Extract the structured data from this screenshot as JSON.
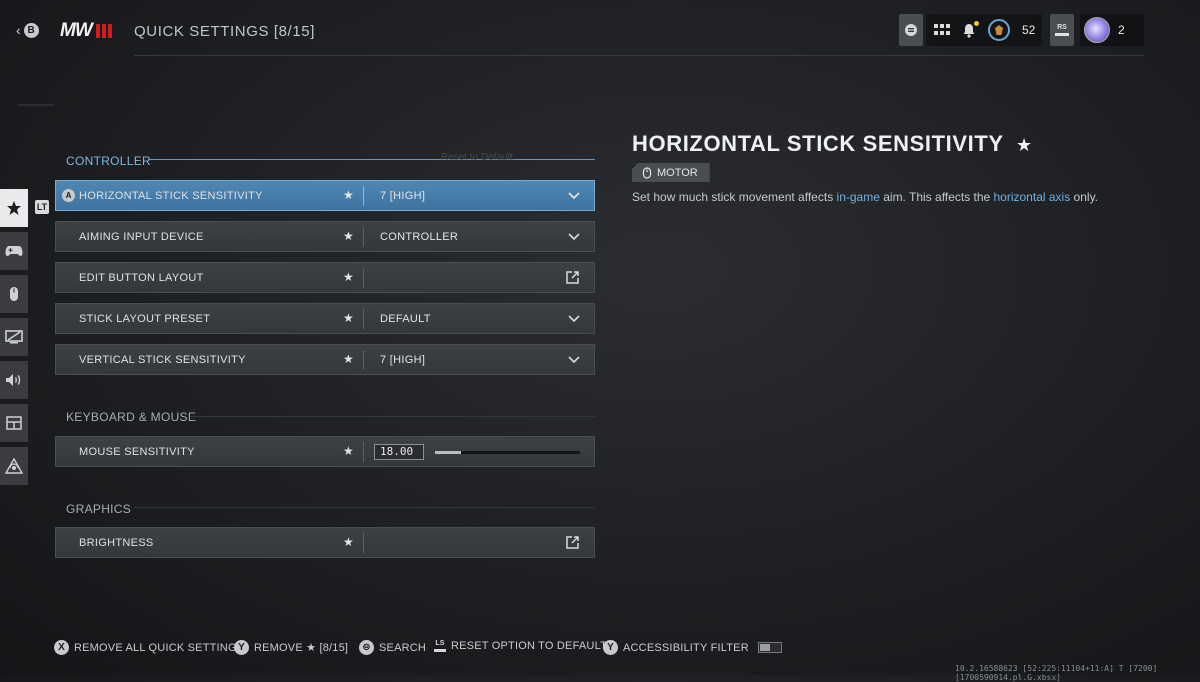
{
  "header": {
    "back_button_label": "B",
    "logo_text": "MW",
    "title": "QUICK SETTINGS [8/15]",
    "rank_value": "52",
    "rs_label": "RS",
    "player_count": "2"
  },
  "sidebar": {
    "items": [
      {
        "name": "favorites",
        "icon": "star-icon",
        "active": true
      },
      {
        "name": "controller",
        "icon": "controller-icon",
        "active": false
      },
      {
        "name": "mouse",
        "icon": "mouse-icon",
        "active": false
      },
      {
        "name": "graphics",
        "icon": "monitor-icon",
        "active": false
      },
      {
        "name": "audio",
        "icon": "speaker-icon",
        "active": false
      },
      {
        "name": "interface",
        "icon": "interface-icon",
        "active": false
      },
      {
        "name": "network",
        "icon": "network-icon",
        "active": false
      }
    ],
    "tab_badge": "LT"
  },
  "sections": {
    "controller": {
      "title": "CONTROLLER",
      "faded_action": "Reset to Default",
      "rows": [
        {
          "label": "HORIZONTAL STICK SENSITIVITY",
          "value": "7 [HIGH]",
          "control": "dropdown",
          "selected": true,
          "a_button": "A"
        },
        {
          "label": "AIMING INPUT DEVICE",
          "value": "CONTROLLER",
          "control": "dropdown"
        },
        {
          "label": "EDIT BUTTON LAYOUT",
          "value": "",
          "control": "external"
        },
        {
          "label": "STICK LAYOUT PRESET",
          "value": "DEFAULT",
          "control": "dropdown"
        },
        {
          "label": "VERTICAL STICK SENSITIVITY",
          "value": "7 [HIGH]",
          "control": "dropdown"
        }
      ]
    },
    "keyboard_mouse": {
      "title": "KEYBOARD & MOUSE",
      "rows": [
        {
          "label": "MOUSE SENSITIVITY",
          "value": "18.00",
          "control": "slider",
          "slider_fraction": 0.18
        }
      ]
    },
    "graphics": {
      "title": "GRAPHICS",
      "rows": [
        {
          "label": "BRIGHTNESS",
          "value": "",
          "control": "external"
        }
      ]
    }
  },
  "detail": {
    "title": "HORIZONTAL STICK SENSITIVITY",
    "tag": "MOTOR",
    "desc_1": "Set how much stick movement affects ",
    "desc_hl_1": "in-game",
    "desc_2": " aim. This affects the ",
    "desc_hl_2": "horizontal axis",
    "desc_3": " only."
  },
  "footer": {
    "actions": [
      {
        "button": "X",
        "label": "REMOVE ALL QUICK SETTINGS"
      },
      {
        "button": "Y",
        "label": "REMOVE ★ [8/15]"
      },
      {
        "button": "⊜",
        "label": "SEARCH"
      },
      {
        "button": "LS",
        "label": "RESET OPTION TO DEFAULT"
      },
      {
        "button": "Y",
        "label": "ACCESSIBILITY FILTER"
      }
    ],
    "build_info": "10.2.16588623 [52:225:11104+11:A] T [7200][1700590914.pl.G.xbsx]"
  },
  "colors": {
    "accent_blue": "#4f87b3",
    "highlight_text": "#6fb0e0",
    "brand_red": "#cc1f1f"
  }
}
